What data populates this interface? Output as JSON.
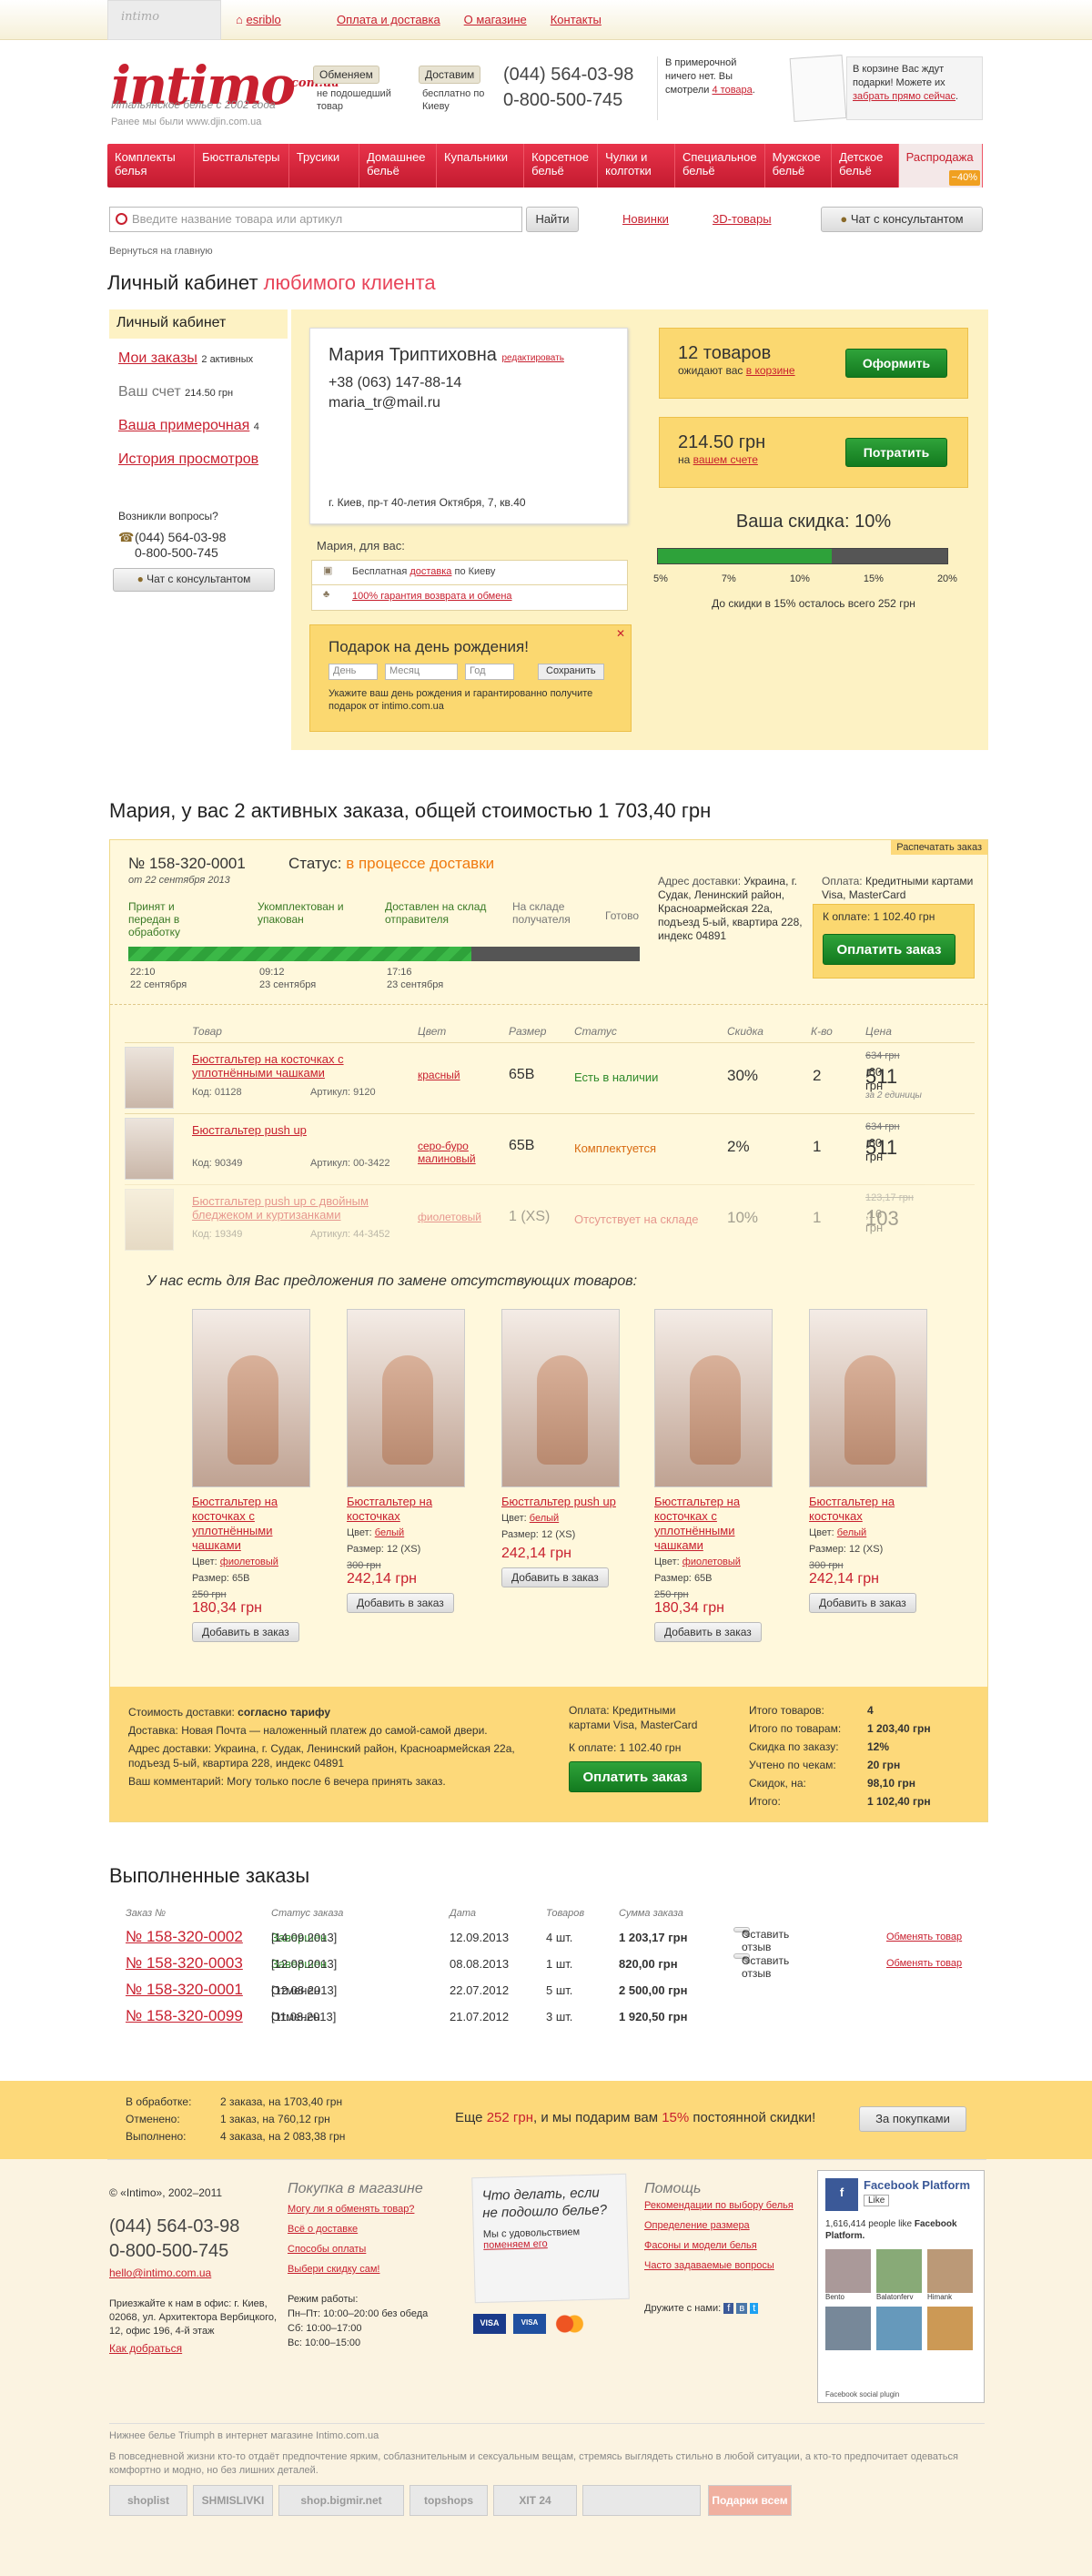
{
  "top": {
    "tab_label": "intimo",
    "user": "esriblo",
    "links": [
      "Оплата и доставка",
      "О магазине",
      "Контакты"
    ]
  },
  "header": {
    "logo": "intimo",
    "logo_suffix": "com.ua",
    "slogan": "Итальянское белье с 2002 года",
    "former": "Ранее мы были www.djin.com.ua",
    "exchange_btn": "Обменяем",
    "exchange_text": "не подошедший товар",
    "delivery_btn": "Доставим",
    "delivery_text": "бесплатно по Киеву",
    "phone1": "(044) 564-03-98",
    "phone2": "0-800-500-745",
    "fitting_text": "В примерочной ничего нет. Вы смотрели",
    "fitting_link": "4 товара",
    "cart_text": "В корзине Вас ждут подарки! Можете их",
    "cart_link": "забрать прямо сейчас"
  },
  "nav": [
    "Комплекты белья",
    "Бюстгальтеры",
    "Трусики",
    "Домашнее бельё",
    "Купальники",
    "Корсетное бельё",
    "Чулки и колготки",
    "Специальное бельё",
    "Мужское бельё",
    "Детское бельё",
    "Распродажа"
  ],
  "nav_sale_badge": "−40%",
  "search": {
    "placeholder": "Введите название товара или артикул",
    "button": "Найти",
    "link_new": "Новинки",
    "link_3d": "3D-товары",
    "consult": "Чат с консультантом"
  },
  "back": "Вернуться на главную",
  "cabinet": {
    "title": "Личный кабинет",
    "title_accent": "любимого клиента",
    "menu_head": "Личный кабинет",
    "menu": [
      {
        "label": "Мои заказы",
        "note": "2 активных"
      },
      {
        "label": "Ваш счет",
        "note": "214.50 грн"
      },
      {
        "label": "Ваша примерочная",
        "note": "4"
      },
      {
        "label": "История просмотров",
        "note": ""
      }
    ],
    "questions": "Возникли вопросы?",
    "qphone1": "(044) 564-03-98",
    "qphone2": "0-800-500-745",
    "qchat": "Чат с консультантом",
    "name": "Мария Триптиховна",
    "edit": "редактировать",
    "phone": "+38 (063) 147-88-14",
    "email": "maria_tr@mail.ru",
    "address": "г. Киев, пр-т 40-летия Октября, 7, кв.40",
    "for_you": "Мария, для вас:",
    "perk1_pre": "Бесплатная",
    "perk1_link": "доставка",
    "perk1_post": "по Киеву",
    "perk2": "100% гарантия возврата и обмена",
    "bday_title": "Подарок на день рождения!",
    "bday_day": "День",
    "bday_month": "Месяц",
    "bday_year": "Год",
    "bday_save": "Сохранить",
    "bday_text": "Укажите ваш день рождения и гарантированно получите подарок от intimo.com.ua",
    "cart_count": "12 товаров",
    "cart_wait": "ожидают вас",
    "cart_in": "в корзине",
    "checkout": "Оформить",
    "balance": "214.50 грн",
    "balance_pre": "на",
    "balance_link": "вашем счете",
    "spend": "Потратить",
    "discount_title": "Ваша скидка: 10%",
    "discount_level": 0.6,
    "discount_ticks": [
      "5%",
      "7%",
      "10%",
      "15%",
      "20%"
    ],
    "discount_note": "До скидки в 15% осталось всего 252 грн"
  },
  "orders": {
    "title": "Мария, у вас 2 активных заказа, общей стоимостью 1 703,40 грн",
    "print": "Распечатать заказ",
    "number": "№ 158-320-0001",
    "date": "от 22 сентября 2013",
    "status_label": "Статус:",
    "status": "в процессе доставки",
    "stages": [
      "Принят и передан в обработку",
      "Укомплектован и упакован",
      "Доставлен на склад отправителя",
      "На складе получателя",
      "Готово"
    ],
    "stage_times": [
      {
        "t": "22:10",
        "d": "22 сентября"
      },
      {
        "t": "09:12",
        "d": "23 сентября"
      },
      {
        "t": "17:16",
        "d": "23 сентября"
      }
    ],
    "progress": 0.67,
    "addr_label": "Адрес доставки:",
    "addr": "Украина, г. Судак, Ленинский район, Красноармейская 22а, подъезд 5-ый, квартира 228, индекс 04891",
    "pay_label": "Оплата:",
    "pay": "Кредитными картами Visa, MasterCard",
    "due_label": "К оплате:",
    "due": "1 102.40 грн",
    "pay_btn": "Оплатить заказ",
    "cols": [
      "Товар",
      "Цвет",
      "Размер",
      "Статус",
      "Скидка",
      "К-во",
      "Цена"
    ],
    "items": [
      {
        "name": "Бюстгальтер на косточках с уплотнёнными чашками",
        "code": "Код: 01128",
        "art": "Артикул: 9120",
        "color": "красный",
        "size": "65B",
        "status": "Есть в наличии",
        "disc": "30%",
        "qty": "2",
        "old": "634 грн",
        "price": "511",
        "cents": ",60 грн",
        "note": "за 2 единицы"
      },
      {
        "name": "Бюстгальтер push up",
        "code": "Код: 90349",
        "art": "Артикул: 00-3422",
        "color": "серо-буро малиновый",
        "size": "65B",
        "status": "Комплектуется",
        "disc": "2%",
        "qty": "1",
        "old": "634 грн",
        "price": "511",
        "cents": ",60 грн",
        "note": ""
      },
      {
        "name": "Бюстгальтер push up с двойным бледжеком и куртизанками",
        "code": "Код: 19349",
        "art": "Артикул: 44-3452",
        "color": "фиолетовый",
        "size": "1 (XS)",
        "status": "Отсутствует на складе",
        "disc": "10%",
        "qty": "1",
        "old": "123,17 грн",
        "price": "103",
        "cents": ",16 грн",
        "note": ""
      }
    ],
    "offer_title": "У нас есть для Вас предложения по замене отсутствующих товаров:",
    "offers": [
      {
        "name": "Бюстгальтер на косточках с уплотнёнными чашками",
        "color": "фиолетовый",
        "size": "65B",
        "old": "250 грн",
        "price": "180,34 грн"
      },
      {
        "name": "Бюстгальтер на косточках",
        "color": "белый",
        "size": "12 (XS)",
        "old": "300 грн",
        "price": "242,14 грн"
      },
      {
        "name": "Бюстгальтер push up",
        "color": "белый",
        "size": "12 (XS)",
        "old": "",
        "price": "242,14 грн"
      },
      {
        "name": "Бюстгальтер на косточках с уплотнёнными чашками",
        "color": "фиолетовый",
        "size": "65B",
        "old": "250 грн",
        "price": "180,34 грн"
      },
      {
        "name": "Бюстгальтер на косточках",
        "color": "белый",
        "size": "12 (XS)",
        "old": "300 грн",
        "price": "242,14 грн"
      }
    ],
    "offer_color": "Цвет:",
    "offer_size": "Размер:",
    "offer_add": "Добавить в заказ",
    "foot": {
      "ship_cost": "Стоимость доставки:",
      "ship_cost_v": "согласно тарифу",
      "delivery": "Доставка:",
      "delivery_v": "Новая Почта — наложенный платеж до самой-самой двери.",
      "addr": "Адрес доставки:",
      "addr_v": "Украина, г. Судак, Ленинский район, Красноармейская 22а, подъезд 5-ый, квартира 228, индекс 04891",
      "comment": "Ваш комментарий:",
      "comment_v": "Могу только после 6 вечера принять заказ.",
      "pay": "Оплата:",
      "pay_v": "Кредитными картами Visa, MasterCard",
      "due": "К оплате:",
      "due_v": "1 102.40 грн",
      "pay_btn": "Оплатить заказ",
      "totals": [
        [
          "Итого товаров:",
          "4"
        ],
        [
          "Итого по товарам:",
          "1 203,40 грн"
        ],
        [
          "Скидка по заказу:",
          "12%"
        ],
        [
          "Учтено по чекам:",
          "20 грн"
        ],
        [
          "Скидок, на:",
          "98,10 грн"
        ],
        [
          "Итого:",
          "1 102,40 грн"
        ]
      ]
    }
  },
  "done": {
    "title": "Выполненные заказы",
    "cols": [
      "Заказ №",
      "Статус заказа",
      "Дата",
      "Товаров",
      "Сумма заказа"
    ],
    "rows": [
      {
        "no": "№ 158-320-0002",
        "st": "Завершен",
        "std": "[14.09.2013]",
        "date": "12.09.2013",
        "qty": "4 шт.",
        "sum": "1 203,17 грн",
        "review": "Оставить отзыв",
        "swap": "Обменять товар"
      },
      {
        "no": "№ 158-320-0003",
        "st": "Завершен",
        "std": "[12.08.2013]",
        "date": "08.08.2013",
        "qty": "1 шт.",
        "sum": "820,00 грн",
        "review": "Оставить отзыв",
        "swap": "Обменять товар"
      },
      {
        "no": "№ 158-320-0001",
        "st": "Отменен",
        "std": "[12.08.2013]",
        "date": "22.07.2012",
        "qty": "5 шт.",
        "sum": "2 500,00 грн",
        "review": "",
        "swap": ""
      },
      {
        "no": "№ 158-320-0099",
        "st": "Отменен",
        "std": "[11.08.2013]",
        "date": "21.07.2012",
        "qty": "3 шт.",
        "sum": "1 920,50 грн",
        "review": "",
        "swap": ""
      }
    ]
  },
  "summary": {
    "r1l": "В обработке:",
    "r1v": "2 заказа, на 1703,40 грн",
    "r2l": "Отменено:",
    "r2v": "1 заказ, на 760,12 грн",
    "r3l": "Выполнено:",
    "r3v": "4 заказа, на 2 083,38 грн",
    "pre": "Еще",
    "amt": "252 грн",
    "mid": ", и мы подарим вам",
    "pct": "15%",
    "post": "постоянной скидки!",
    "btn": "За покупками"
  },
  "footer": {
    "copy": "© «Intimo», 2002–2011",
    "phone1": "(044) 564-03-98",
    "phone2": "0-800-500-745",
    "email": "hello@intimo.com.ua",
    "office": "Приезжайте к нам в офис: г. Киев, 02068, ул. Архитектора Вербицкого, 12, офис 196, 4-й этаж",
    "route": "Как добраться",
    "shop_title": "Покупка в магазине",
    "shop_links": [
      "Могу ли я обменять товар?",
      "Всё о доставке",
      "Способы оплаты",
      "Выбери скидку сам!"
    ],
    "hours_title": "Режим работы:",
    "hours": [
      "Пн–Пт: 10:00–20:00 без обеда",
      "Сб: 10:00–17:00",
      "Вс: 10:00–15:00"
    ],
    "note_title": "Что делать, если не подошло белье?",
    "note_text": "Мы с удовольствием",
    "note_link": "поменяем его",
    "help_title": "Помощь",
    "help_links": [
      "Рекомендации по выбору белья",
      "Определение размера",
      "Фасоны и модели белья",
      "Часто задаваемые вопросы"
    ],
    "friends": "Дружите с нами:",
    "fb_title": "Facebook Platform",
    "fb_like": "Like",
    "fb_count": "1,616,414 people like",
    "fb_name": "Facebook Platform.",
    "fb_people": [
      "Bento",
      "Balatonferv",
      "Himank"
    ],
    "fb_plugin": "Facebook social plugin",
    "seo1": "Нижнее белье Triumph в интернет магазине Intimo.com.ua",
    "seo2": "В повседневной жизни кто-то отдаёт предпочтение ярким, соблазнительным и сексуальным вещам, стремясь выглядеть стильно в любой ситуации, а кто-то предпочитает одеваться комфортно и модно, но без лишних деталей.",
    "badges": [
      "shoplist",
      "SHMISLIVKI",
      "shop.bigmir.net",
      "topshops",
      "XIT 24",
      "",
      "Подарки всем"
    ]
  }
}
